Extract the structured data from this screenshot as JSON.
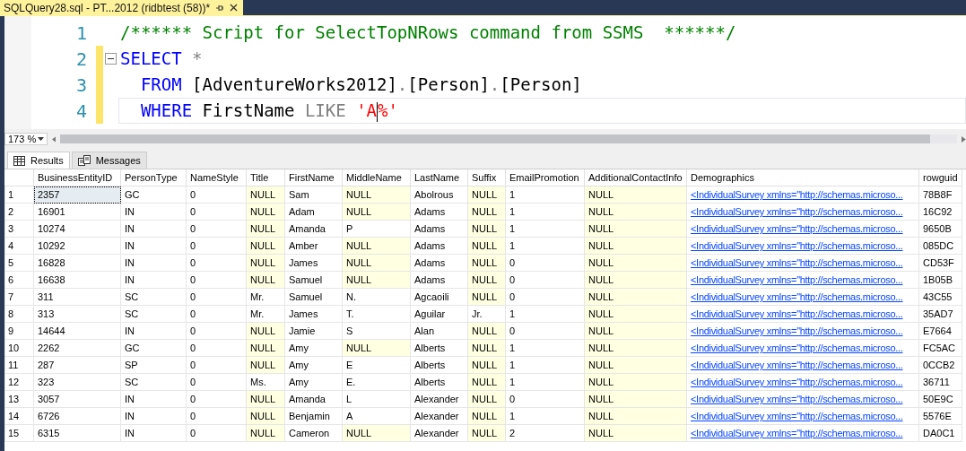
{
  "document_tab": {
    "title": "SQLQuery28.sql - PT...2012 (ridbtest (58))*",
    "modified": true
  },
  "editor": {
    "lines": [
      {
        "number": "1",
        "modified": false,
        "collapsible": false,
        "current": false,
        "tokens": [
          {
            "kind": "comment",
            "text": "/****** Script for SelectTopNRows command from SSMS  ******/"
          }
        ]
      },
      {
        "number": "2",
        "modified": true,
        "collapsible": true,
        "current": false,
        "tokens": [
          {
            "kind": "keyword",
            "text": "SELECT"
          },
          {
            "kind": "operator",
            "text": " *"
          }
        ]
      },
      {
        "number": "3",
        "modified": true,
        "collapsible": false,
        "current": false,
        "tokens": [
          {
            "kind": "keyword",
            "text": "  FROM"
          },
          {
            "kind": "identifier",
            "text": " [AdventureWorks2012]"
          },
          {
            "kind": "operator",
            "text": "."
          },
          {
            "kind": "identifier",
            "text": "[Person]"
          },
          {
            "kind": "operator",
            "text": "."
          },
          {
            "kind": "identifier",
            "text": "[Person]"
          }
        ]
      },
      {
        "number": "4",
        "modified": true,
        "collapsible": false,
        "current": true,
        "tokens": [
          {
            "kind": "keyword",
            "text": "  WHERE"
          },
          {
            "kind": "identifier",
            "text": " FirstName "
          },
          {
            "kind": "operator",
            "text": "LIKE"
          },
          {
            "kind": "string",
            "text": " 'A"
          },
          {
            "kind": "caret"
          },
          {
            "kind": "string",
            "text": "%'"
          }
        ]
      }
    ]
  },
  "zoom": {
    "value": "173 %"
  },
  "result_tabs": [
    {
      "label": "Results",
      "selected": true
    },
    {
      "label": "Messages",
      "selected": false
    }
  ],
  "grid": {
    "columns": [
      {
        "label": "BusinessEntityID",
        "kind": "text"
      },
      {
        "label": "PersonType",
        "kind": "text"
      },
      {
        "label": "NameStyle",
        "kind": "text"
      },
      {
        "label": "Title",
        "kind": "text"
      },
      {
        "label": "FirstName",
        "kind": "text"
      },
      {
        "label": "MiddleName",
        "kind": "text"
      },
      {
        "label": "LastName",
        "kind": "text"
      },
      {
        "label": "Suffix",
        "kind": "text"
      },
      {
        "label": "EmailPromotion",
        "kind": "text"
      },
      {
        "label": "AdditionalContactInfo",
        "kind": "text"
      },
      {
        "label": "Demographics",
        "kind": "link"
      },
      {
        "label": "rowguid",
        "kind": "text"
      }
    ],
    "rows": [
      {
        "number": "1",
        "cells": [
          {
            "text": "2357",
            "focused": true
          },
          {
            "text": "GC"
          },
          {
            "text": "0"
          },
          {
            "text": "NULL",
            "null": true
          },
          {
            "text": "Sam"
          },
          {
            "text": "NULL",
            "null": true
          },
          {
            "text": "Abolrous"
          },
          {
            "text": "NULL",
            "null": true
          },
          {
            "text": "1"
          },
          {
            "text": "NULL",
            "null": true
          },
          {
            "text": "<IndividualSurvey xmlns=\"http://schemas.microso..."
          },
          {
            "text": "78B8F"
          }
        ]
      },
      {
        "number": "2",
        "cells": [
          {
            "text": "16901"
          },
          {
            "text": "IN"
          },
          {
            "text": "0"
          },
          {
            "text": "NULL",
            "null": true
          },
          {
            "text": "Adam"
          },
          {
            "text": "NULL",
            "null": true
          },
          {
            "text": "Adams"
          },
          {
            "text": "NULL",
            "null": true
          },
          {
            "text": "1"
          },
          {
            "text": "NULL",
            "null": true
          },
          {
            "text": "<IndividualSurvey xmlns=\"http://schemas.microso..."
          },
          {
            "text": "16C92"
          }
        ]
      },
      {
        "number": "3",
        "cells": [
          {
            "text": "10274"
          },
          {
            "text": "IN"
          },
          {
            "text": "0"
          },
          {
            "text": "NULL",
            "null": true
          },
          {
            "text": "Amanda"
          },
          {
            "text": "P"
          },
          {
            "text": "Adams"
          },
          {
            "text": "NULL",
            "null": true
          },
          {
            "text": "1"
          },
          {
            "text": "NULL",
            "null": true
          },
          {
            "text": "<IndividualSurvey xmlns=\"http://schemas.microso..."
          },
          {
            "text": "9650B"
          }
        ]
      },
      {
        "number": "4",
        "cells": [
          {
            "text": "10292"
          },
          {
            "text": "IN"
          },
          {
            "text": "0"
          },
          {
            "text": "NULL",
            "null": true
          },
          {
            "text": "Amber"
          },
          {
            "text": "NULL",
            "null": true
          },
          {
            "text": "Adams"
          },
          {
            "text": "NULL",
            "null": true
          },
          {
            "text": "1"
          },
          {
            "text": "NULL",
            "null": true
          },
          {
            "text": "<IndividualSurvey xmlns=\"http://schemas.microso..."
          },
          {
            "text": "085DC"
          }
        ]
      },
      {
        "number": "5",
        "cells": [
          {
            "text": "16828"
          },
          {
            "text": "IN"
          },
          {
            "text": "0"
          },
          {
            "text": "NULL",
            "null": true
          },
          {
            "text": "James"
          },
          {
            "text": "NULL",
            "null": true
          },
          {
            "text": "Adams"
          },
          {
            "text": "NULL",
            "null": true
          },
          {
            "text": "0"
          },
          {
            "text": "NULL",
            "null": true
          },
          {
            "text": "<IndividualSurvey xmlns=\"http://schemas.microso..."
          },
          {
            "text": "CD53F"
          }
        ]
      },
      {
        "number": "6",
        "cells": [
          {
            "text": "16638"
          },
          {
            "text": "IN"
          },
          {
            "text": "0"
          },
          {
            "text": "NULL",
            "null": true
          },
          {
            "text": "Samuel"
          },
          {
            "text": "NULL",
            "null": true
          },
          {
            "text": "Adams"
          },
          {
            "text": "NULL",
            "null": true
          },
          {
            "text": "0"
          },
          {
            "text": "NULL",
            "null": true
          },
          {
            "text": "<IndividualSurvey xmlns=\"http://schemas.microso..."
          },
          {
            "text": "1B05B"
          }
        ]
      },
      {
        "number": "7",
        "cells": [
          {
            "text": "311"
          },
          {
            "text": "SC"
          },
          {
            "text": "0"
          },
          {
            "text": "Mr."
          },
          {
            "text": "Samuel"
          },
          {
            "text": "N."
          },
          {
            "text": "Agcaoili"
          },
          {
            "text": "NULL",
            "null": true
          },
          {
            "text": "0"
          },
          {
            "text": "NULL",
            "null": true
          },
          {
            "text": "<IndividualSurvey xmlns=\"http://schemas.microso..."
          },
          {
            "text": "43C55"
          }
        ]
      },
      {
        "number": "8",
        "cells": [
          {
            "text": "313"
          },
          {
            "text": "SC"
          },
          {
            "text": "0"
          },
          {
            "text": "Mr."
          },
          {
            "text": "James"
          },
          {
            "text": "T."
          },
          {
            "text": "Aguilar"
          },
          {
            "text": "Jr."
          },
          {
            "text": "1"
          },
          {
            "text": "NULL",
            "null": true
          },
          {
            "text": "<IndividualSurvey xmlns=\"http://schemas.microso..."
          },
          {
            "text": "35AD7"
          }
        ]
      },
      {
        "number": "9",
        "cells": [
          {
            "text": "14644"
          },
          {
            "text": "IN"
          },
          {
            "text": "0"
          },
          {
            "text": "NULL",
            "null": true
          },
          {
            "text": "Jamie"
          },
          {
            "text": "S"
          },
          {
            "text": "Alan"
          },
          {
            "text": "NULL",
            "null": true
          },
          {
            "text": "0"
          },
          {
            "text": "NULL",
            "null": true
          },
          {
            "text": "<IndividualSurvey xmlns=\"http://schemas.microso..."
          },
          {
            "text": "E7664"
          }
        ]
      },
      {
        "number": "10",
        "cells": [
          {
            "text": "2262"
          },
          {
            "text": "GC"
          },
          {
            "text": "0"
          },
          {
            "text": "NULL",
            "null": true
          },
          {
            "text": "Amy"
          },
          {
            "text": "NULL",
            "null": true
          },
          {
            "text": "Alberts"
          },
          {
            "text": "NULL",
            "null": true
          },
          {
            "text": "1"
          },
          {
            "text": "NULL",
            "null": true
          },
          {
            "text": "<IndividualSurvey xmlns=\"http://schemas.microso..."
          },
          {
            "text": "FC5AC"
          }
        ]
      },
      {
        "number": "11",
        "cells": [
          {
            "text": "287"
          },
          {
            "text": "SP"
          },
          {
            "text": "0"
          },
          {
            "text": "NULL",
            "null": true
          },
          {
            "text": "Amy"
          },
          {
            "text": "E"
          },
          {
            "text": "Alberts"
          },
          {
            "text": "NULL",
            "null": true
          },
          {
            "text": "1"
          },
          {
            "text": "NULL",
            "null": true
          },
          {
            "text": "<IndividualSurvey xmlns=\"http://schemas.microso..."
          },
          {
            "text": "0CCB2"
          }
        ]
      },
      {
        "number": "12",
        "cells": [
          {
            "text": "323"
          },
          {
            "text": "SC"
          },
          {
            "text": "0"
          },
          {
            "text": "Ms."
          },
          {
            "text": "Amy"
          },
          {
            "text": "E."
          },
          {
            "text": "Alberts"
          },
          {
            "text": "NULL",
            "null": true
          },
          {
            "text": "1"
          },
          {
            "text": "NULL",
            "null": true
          },
          {
            "text": "<IndividualSurvey xmlns=\"http://schemas.microso..."
          },
          {
            "text": "36711"
          }
        ]
      },
      {
        "number": "13",
        "cells": [
          {
            "text": "3057"
          },
          {
            "text": "IN"
          },
          {
            "text": "0"
          },
          {
            "text": "NULL",
            "null": true
          },
          {
            "text": "Amanda"
          },
          {
            "text": "L"
          },
          {
            "text": "Alexander"
          },
          {
            "text": "NULL",
            "null": true
          },
          {
            "text": "0"
          },
          {
            "text": "NULL",
            "null": true
          },
          {
            "text": "<IndividualSurvey xmlns=\"http://schemas.microso..."
          },
          {
            "text": "50E9C"
          }
        ]
      },
      {
        "number": "14",
        "cells": [
          {
            "text": "6726"
          },
          {
            "text": "IN"
          },
          {
            "text": "0"
          },
          {
            "text": "NULL",
            "null": true
          },
          {
            "text": "Benjamin"
          },
          {
            "text": "A"
          },
          {
            "text": "Alexander"
          },
          {
            "text": "NULL",
            "null": true
          },
          {
            "text": "1"
          },
          {
            "text": "NULL",
            "null": true
          },
          {
            "text": "<IndividualSurvey xmlns=\"http://schemas.microso..."
          },
          {
            "text": "5576E"
          }
        ]
      },
      {
        "number": "15",
        "cells": [
          {
            "text": "6315"
          },
          {
            "text": "IN"
          },
          {
            "text": "0"
          },
          {
            "text": "NULL",
            "null": true
          },
          {
            "text": "Cameron"
          },
          {
            "text": "NULL",
            "null": true
          },
          {
            "text": "Alexander"
          },
          {
            "text": "NULL",
            "null": true
          },
          {
            "text": "2"
          },
          {
            "text": "NULL",
            "null": true
          },
          {
            "text": "<IndividualSurvey xmlns=\"http://schemas.microso..."
          },
          {
            "text": "DA0C1"
          }
        ]
      }
    ]
  }
}
